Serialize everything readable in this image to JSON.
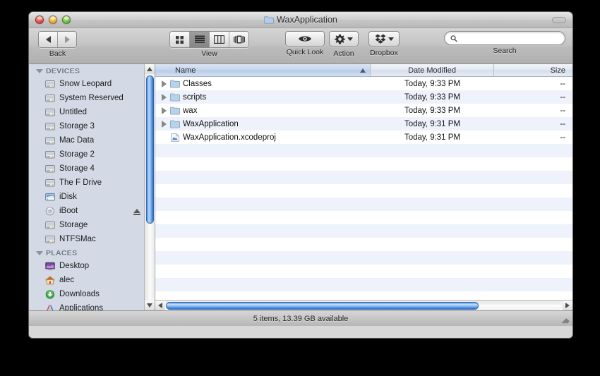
{
  "window": {
    "title": "WaxApplication",
    "title_icon": "folder-icon",
    "traffic_lights": [
      "close-button",
      "minimize-button",
      "zoom-button"
    ],
    "toolbar_toggle": "toolbar-toggle-button"
  },
  "toolbar": {
    "back_label": "Back",
    "back_icon": "arrow-left-icon",
    "forward_icon": "arrow-right-icon",
    "view_label": "View",
    "view_modes": [
      {
        "name": "icon-view",
        "icon": "grid-icon",
        "selected": false
      },
      {
        "name": "list-view",
        "icon": "list-lines-icon",
        "selected": true
      },
      {
        "name": "column-view",
        "icon": "columns-icon",
        "selected": false
      },
      {
        "name": "coverflow-view",
        "icon": "coverflow-icon",
        "selected": false
      }
    ],
    "quicklook_label": "Quick Look",
    "quicklook_icon": "eye-icon",
    "action_label": "Action",
    "action_icon": "gear-icon",
    "dropbox_label": "Dropbox",
    "dropbox_icon": "dropbox-icon",
    "search_label": "Search",
    "search_icon": "magnifier-icon",
    "search_value": "",
    "search_placeholder": ""
  },
  "sidebar": {
    "sections": [
      {
        "name": "DEVICES",
        "items": [
          {
            "label": "Snow Leopard",
            "icon": "hard-drive-icon",
            "eject": false
          },
          {
            "label": "System Reserved",
            "icon": "hard-drive-icon",
            "eject": false
          },
          {
            "label": "Untitled",
            "icon": "hard-drive-icon",
            "eject": false
          },
          {
            "label": "Storage 3",
            "icon": "hard-drive-icon",
            "eject": false
          },
          {
            "label": "Mac Data",
            "icon": "hard-drive-icon",
            "eject": false
          },
          {
            "label": "Storage 2",
            "icon": "hard-drive-icon",
            "eject": false
          },
          {
            "label": "Storage 4",
            "icon": "hard-drive-icon",
            "eject": false
          },
          {
            "label": "The F Drive",
            "icon": "hard-drive-icon",
            "eject": false
          },
          {
            "label": "iDisk",
            "icon": "idisk-icon",
            "eject": false
          },
          {
            "label": "iBoot",
            "icon": "optical-disc-icon",
            "eject": true
          },
          {
            "label": "Storage",
            "icon": "hard-drive-icon",
            "eject": false
          },
          {
            "label": "NTFSMac",
            "icon": "hard-drive-icon",
            "eject": false
          }
        ]
      },
      {
        "name": "PLACES",
        "items": [
          {
            "label": "Desktop",
            "icon": "desktop-icon",
            "eject": false
          },
          {
            "label": "alec",
            "icon": "home-icon",
            "eject": false
          },
          {
            "label": "Downloads",
            "icon": "downloads-icon",
            "eject": false
          },
          {
            "label": "Applications",
            "icon": "applications-icon",
            "eject": false
          }
        ]
      }
    ]
  },
  "file_list": {
    "columns": [
      {
        "label": "Name",
        "sorted": true,
        "sort_direction": "ascending"
      },
      {
        "label": "Date Modified",
        "sorted": false
      },
      {
        "label": "Size",
        "sorted": false
      }
    ],
    "rows": [
      {
        "name": "Classes",
        "icon": "folder-icon",
        "expandable": true,
        "date": "Today, 9:33 PM",
        "size": "--"
      },
      {
        "name": "scripts",
        "icon": "folder-icon",
        "expandable": true,
        "date": "Today, 9:33 PM",
        "size": "--"
      },
      {
        "name": "wax",
        "icon": "folder-icon",
        "expandable": true,
        "date": "Today, 9:33 PM",
        "size": "--"
      },
      {
        "name": "WaxApplication",
        "icon": "folder-icon",
        "expandable": true,
        "date": "Today, 9:31 PM",
        "size": "--"
      },
      {
        "name": "WaxApplication.xcodeproj",
        "icon": "xcodeproj-icon",
        "expandable": false,
        "date": "Today, 9:31 PM",
        "size": "--"
      }
    ]
  },
  "status": {
    "text": "5 items, 13.39 GB available"
  },
  "colors": {
    "row_stripe": "#edf2fb",
    "sidebar_bg": "#d3dae6",
    "scrollbar_blue": "#4f8fe0",
    "folder_blue": "#a8c6e2"
  }
}
